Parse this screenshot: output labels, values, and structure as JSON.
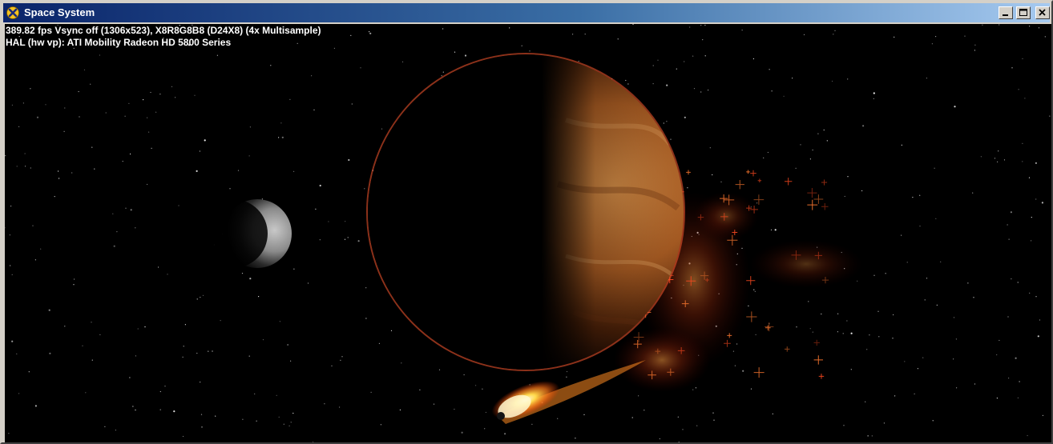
{
  "window": {
    "title": "Space System",
    "icon": "directx-x-icon",
    "controls": [
      "minimize",
      "maximize",
      "close"
    ]
  },
  "stats": {
    "line1": "389.82 fps Vsync off (1306x523), X8R8G8B8 (D24X8) (4x Multisample)",
    "line2": "HAL (hw vp): ATI Mobility Radeon HD 5800 Series"
  },
  "scene": {
    "objects": [
      "starfield",
      "moon",
      "planet",
      "glowing-particles",
      "comet"
    ],
    "colors": {
      "titlebar_start": "#0a246a",
      "titlebar_end": "#a6caf0",
      "planet_surface": "#b0652a",
      "planet_rim": "#ff6a3a",
      "comet_core": "#fff6c0",
      "background": "#000000"
    }
  }
}
